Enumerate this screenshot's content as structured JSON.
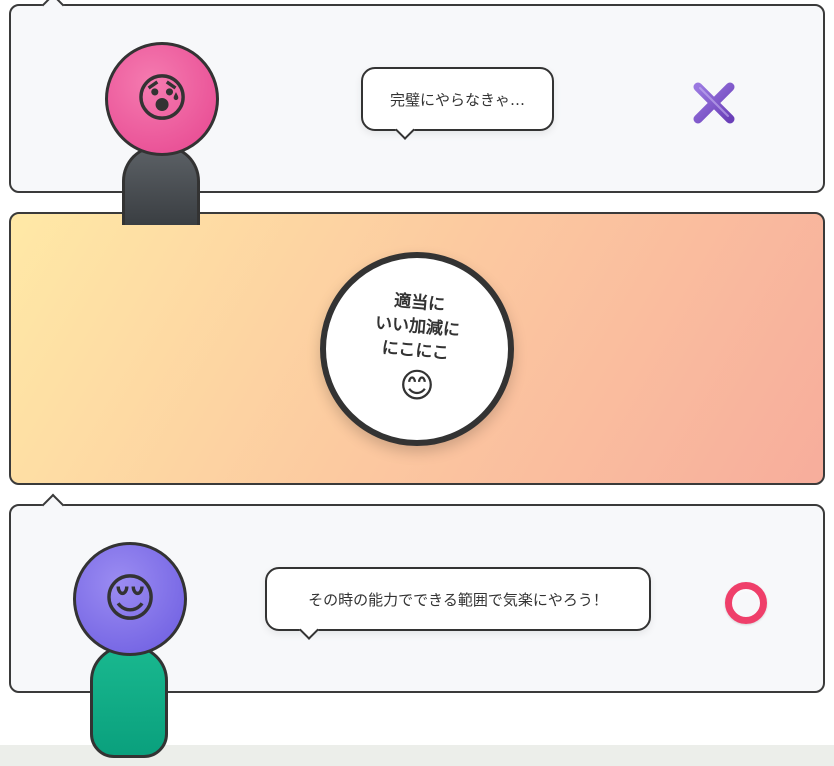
{
  "top_panel": {
    "speech": "完璧にやらなきゃ…",
    "face_emoji": "😰",
    "mark_icon": "cross-mark-icon",
    "mark_color": "#7b52c6",
    "face_color": "#e6458f",
    "body_color": "#4a4e52"
  },
  "middle_panel": {
    "lines": [
      "適当に",
      "いい加減に",
      "にこにこ"
    ],
    "emoji": "😊"
  },
  "bottom_panel": {
    "speech": "その時の能力でできる範囲で気楽にやろう！",
    "face_emoji": "😌",
    "mark_icon": "circle-mark-icon",
    "mark_color": "#ef3f6a",
    "face_color": "#6b5be0",
    "body_color": "#0aa07d"
  }
}
